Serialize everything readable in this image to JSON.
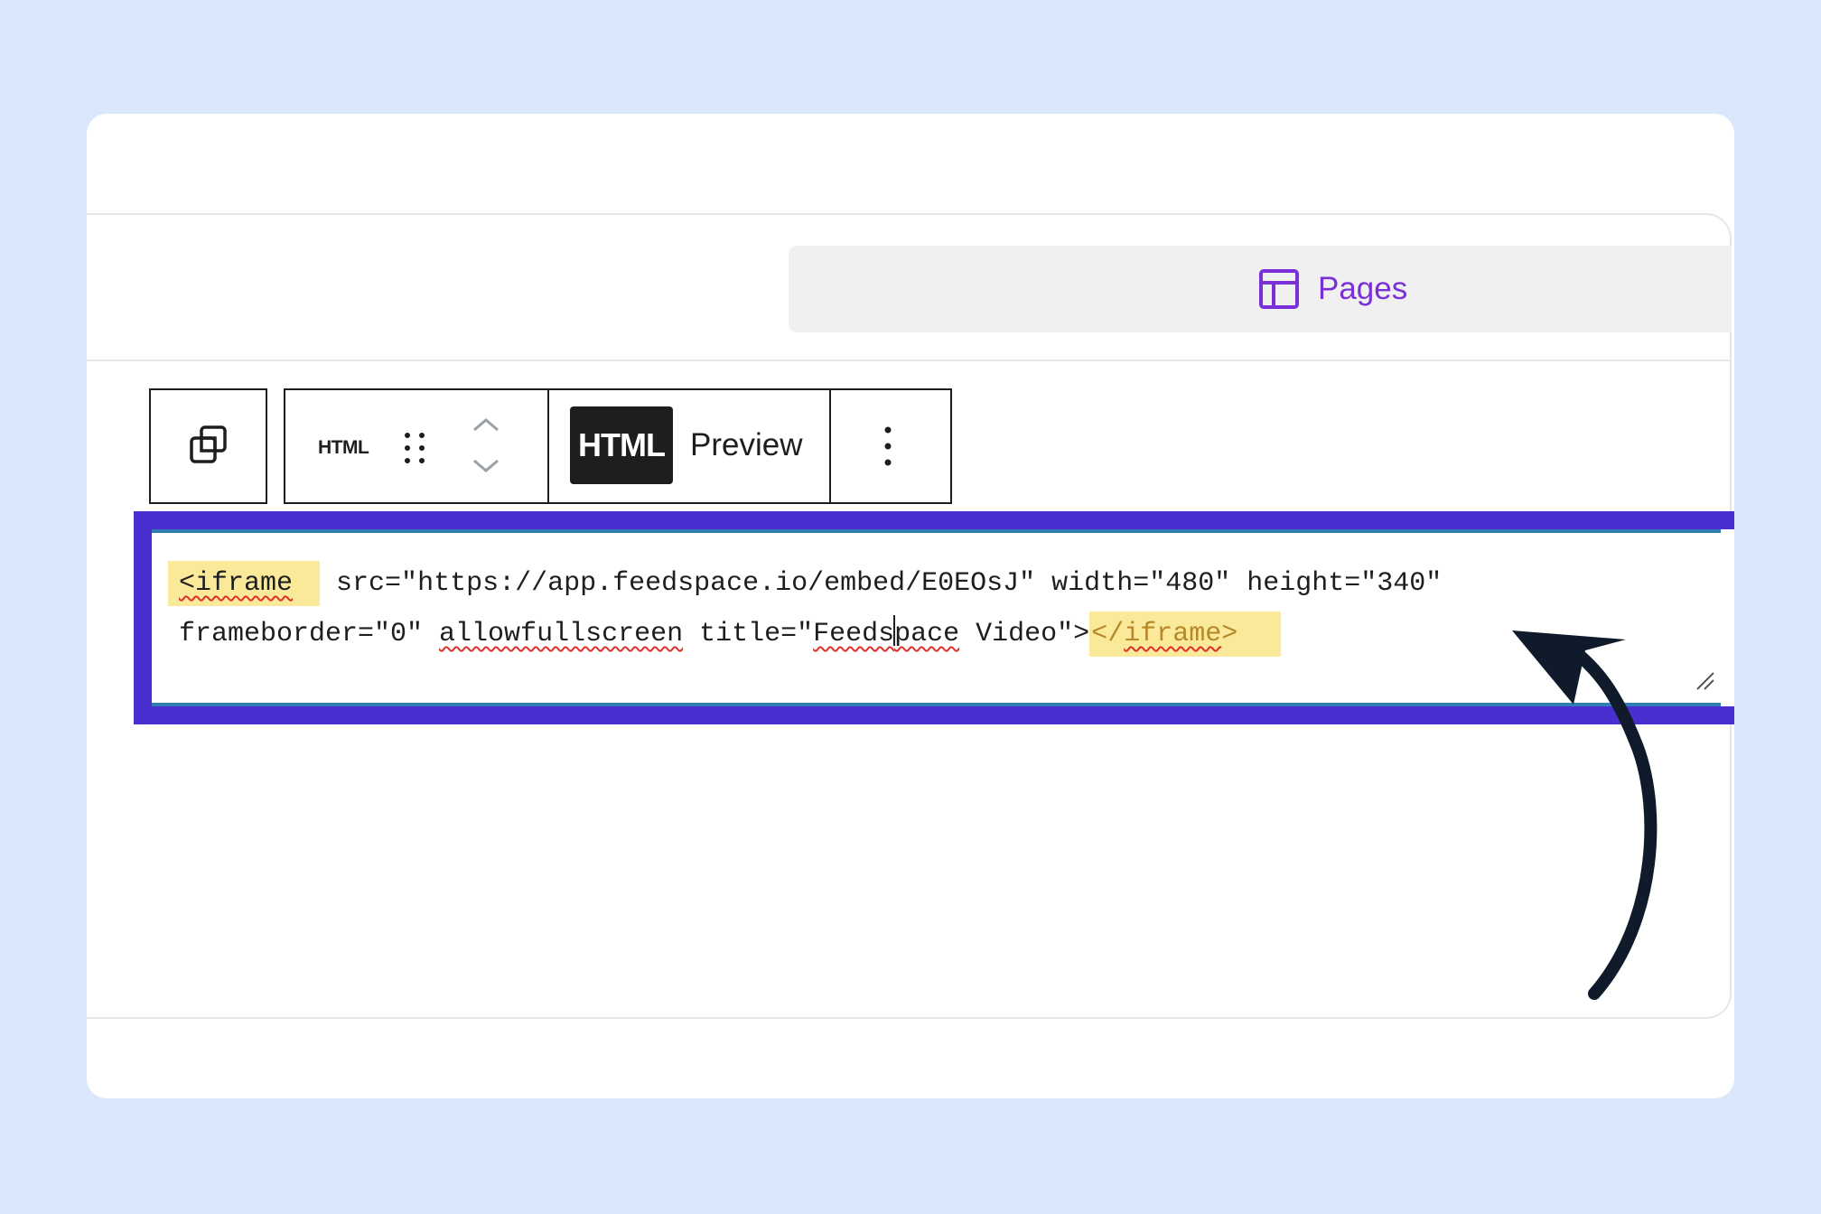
{
  "topbar": {
    "pages_label": "Pages",
    "pages_icon": "layout-icon",
    "accent": "#7b2fd6"
  },
  "toolbar": {
    "copy_icon": "duplicate-icon",
    "block_type_label": "HTML",
    "drag_icon": "drag-handle-icon",
    "move_icons": [
      "chevron-up-icon",
      "chevron-down-icon"
    ],
    "tabs": [
      {
        "label": "HTML",
        "selected": true
      },
      {
        "label": "Preview",
        "selected": false
      }
    ],
    "more_icon": "more-vertical-icon"
  },
  "editor": {
    "line1": {
      "open_tag": "<iframe",
      "rest": " src=\"https://app.feedspace.io/embed/E0EOsJ\" width=\"480\" height=\"340\""
    },
    "line2": {
      "part1": "frameborder=\"0\" ",
      "attr_allow": "allowfullscreen",
      "part2": " title=\"",
      "title_a": "Feeds",
      "title_b": "pace",
      "part3": " Video\">",
      "close_tag_prefix": "</",
      "close_tag_name": "iframe",
      "close_tag_suffix": ">"
    },
    "highlight_color": "#4a2fd0"
  },
  "annotation": {
    "arrow_icon": "curved-arrow-icon"
  }
}
